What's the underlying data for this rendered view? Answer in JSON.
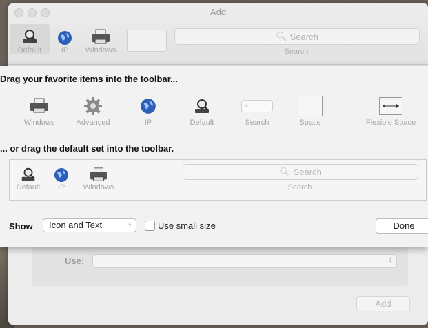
{
  "window": {
    "title": "Add",
    "toolbar": [
      {
        "label": "Default",
        "icon": "default-icon"
      },
      {
        "label": "IP",
        "icon": "globe-icon"
      },
      {
        "label": "Windows",
        "icon": "printer-icon"
      }
    ],
    "search_placeholder": "Search",
    "search_label": "Search",
    "use_label": "Use:",
    "add_button": "Add"
  },
  "sheet": {
    "drag_title": "Drag your favorite items into the toolbar...",
    "palette": [
      {
        "label": "Windows",
        "icon": "printer-icon"
      },
      {
        "label": "Advanced",
        "icon": "gear-icon"
      },
      {
        "label": "IP",
        "icon": "globe-icon"
      },
      {
        "label": "Default",
        "icon": "default-icon"
      },
      {
        "label": "Search",
        "icon": "search-field-icon"
      },
      {
        "label": "Space",
        "icon": "space-icon"
      },
      {
        "label": "Flexible Space",
        "icon": "flexible-space-icon"
      }
    ],
    "default_title": "... or drag the default set into the toolbar.",
    "default_set": [
      {
        "label": "Default",
        "icon": "default-icon"
      },
      {
        "label": "IP",
        "icon": "globe-icon"
      },
      {
        "label": "Windows",
        "icon": "printer-icon"
      }
    ],
    "default_search_placeholder": "Search",
    "default_search_label": "Search",
    "show_label": "Show",
    "show_value": "Icon and Text",
    "small_size_label": "Use small size",
    "small_size_checked": false,
    "done_button": "Done"
  }
}
